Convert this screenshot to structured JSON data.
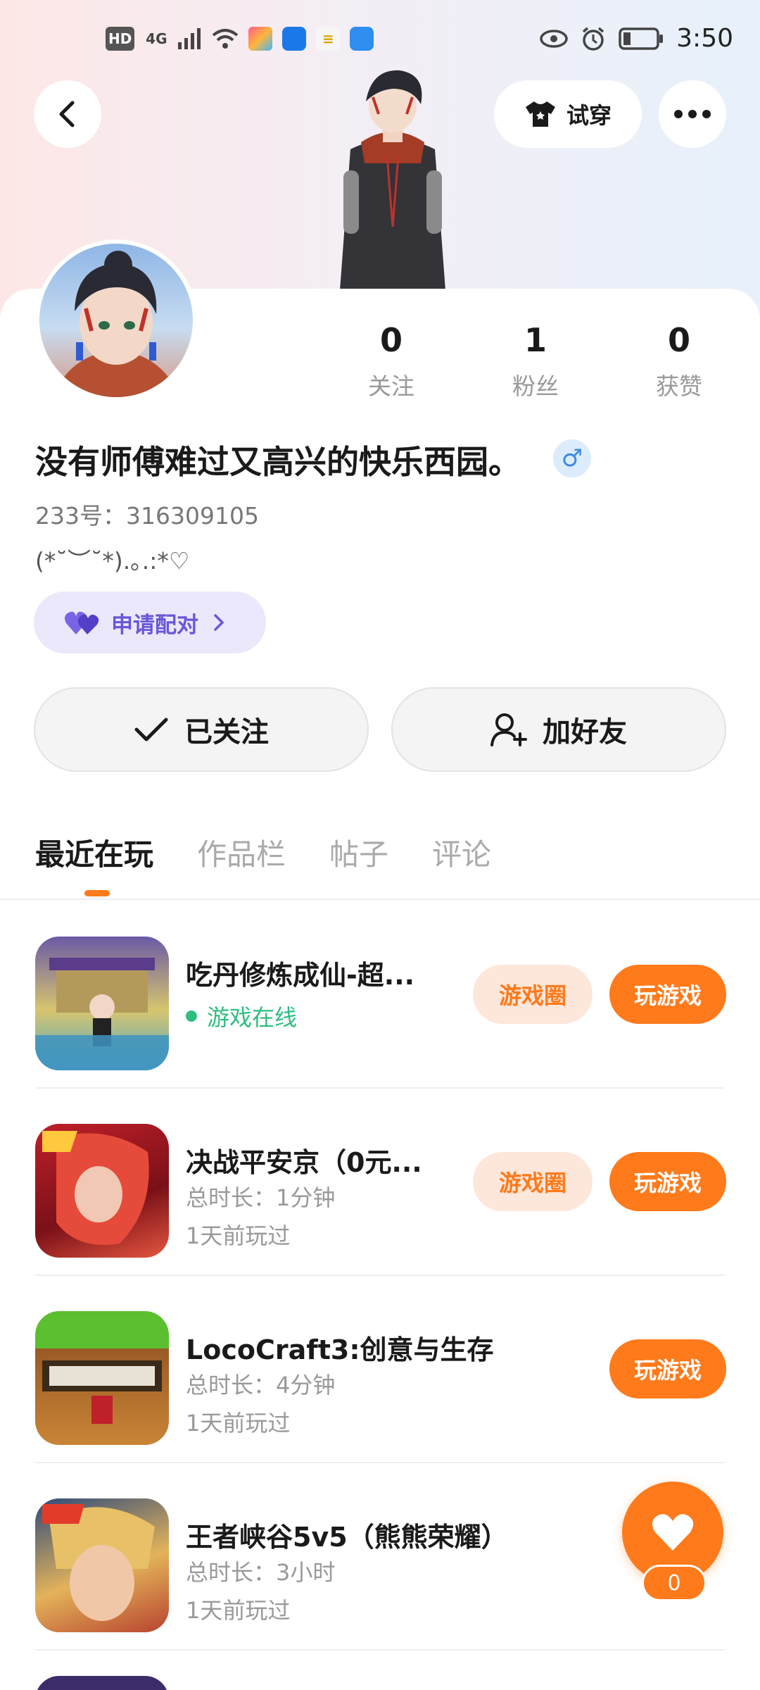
{
  "status_bar": {
    "left_chips": [
      "HD",
      "4G"
    ],
    "time": "3:50"
  },
  "header": {
    "try_on_label": "试穿"
  },
  "profile": {
    "stats": [
      {
        "value": "0",
        "label": "关注"
      },
      {
        "value": "1",
        "label": "粉丝"
      },
      {
        "value": "0",
        "label": "获赞"
      }
    ],
    "nickname": "没有师傅难过又高兴的快乐西园。",
    "gender_symbol": "♂",
    "uid": "233号：316309105",
    "bio": "(*˘︶˘*).｡.:*♡",
    "pair_label": "申请配对"
  },
  "actions": {
    "followed_label": "已关注",
    "add_friend_label": "加好友"
  },
  "tabs": [
    {
      "label": "最近在玩",
      "active": true
    },
    {
      "label": "作品栏",
      "active": false
    },
    {
      "label": "帖子",
      "active": false
    },
    {
      "label": "评论",
      "active": false
    }
  ],
  "games": [
    {
      "title": "吃丹修炼成仙-超...",
      "line1": "游戏在线",
      "online": true,
      "line2": "",
      "circle_btn": "游戏圈",
      "play_btn": "玩游戏",
      "thumb_colors": [
        "#6a5aa6",
        "#d7c56e",
        "#4ea7c9"
      ]
    },
    {
      "title": "决战平安京（0元...",
      "line1": "总时长：1分钟",
      "online": false,
      "line2": "1天前玩过",
      "circle_btn": "游戏圈",
      "play_btn": "玩游戏",
      "thumb_colors": [
        "#c0202a",
        "#7a1018",
        "#e5563f"
      ]
    },
    {
      "title": "LocoCraft3:创意与生存",
      "line1": "总时长：4分钟",
      "online": false,
      "line2": "1天前玩过",
      "circle_btn": "",
      "play_btn": "玩游戏",
      "thumb_colors": [
        "#5bbf2f",
        "#9a5a25",
        "#c98536"
      ]
    },
    {
      "title": "王者峡谷5v5（熊熊荣耀）",
      "line1": "总时长：3小时",
      "online": false,
      "line2": "1天前玩过",
      "circle_btn": "",
      "play_btn": "",
      "thumb_colors": [
        "#2e4a7a",
        "#e3b35a",
        "#b8432f"
      ]
    }
  ],
  "fab": {
    "count": "0"
  },
  "colors": {
    "accent": "#ff7a1a",
    "pair_purple": "#6957d8",
    "online_green": "#2fbe7f"
  }
}
